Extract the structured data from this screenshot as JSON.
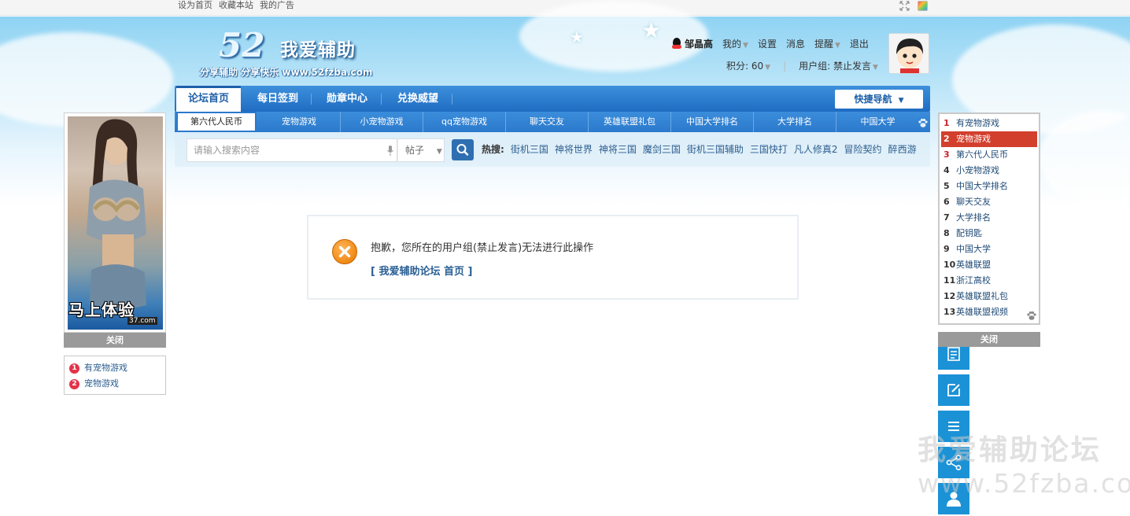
{
  "topbar": {
    "links": [
      "设为首页",
      "收藏本站",
      "我的广告"
    ]
  },
  "logo": {
    "number": "52",
    "title": "我爱辅助",
    "slogan": "分享辅助  分享快乐  www.52fzba.com"
  },
  "user": {
    "name": "邹晶高",
    "menu": [
      "我的",
      "设置",
      "消息",
      "提醒",
      "退出"
    ],
    "points": "积分: 60",
    "group": "用户组: 禁止发言"
  },
  "nav": {
    "tabs": [
      "论坛首页",
      "每日签到",
      "勋章中心",
      "兑换威望"
    ],
    "quick_nav": "快捷导航"
  },
  "subnav": [
    "第六代人民币",
    "宠物游戏",
    "小宠物游戏",
    "qq宠物游戏",
    "聊天交友",
    "英雄联盟礼包",
    "中国大学排名",
    "大学排名",
    "中国大学"
  ],
  "search": {
    "placeholder": "请输入搜索内容",
    "type": "帖子",
    "hot_label": "热搜:",
    "hot": [
      "街机三国",
      "神将世界",
      "神将三国",
      "魔剑三国",
      "街机三国辅助",
      "三国快打",
      "凡人修真2",
      "冒险契约",
      "醉西游"
    ]
  },
  "message": {
    "text": "抱歉，您所在的用户组(禁止发言)无法进行此操作",
    "link": "[ 我爱辅助论坛 首页 ]"
  },
  "left_ad": {
    "text": "马上体验",
    "brand": "37.com",
    "close": "关闭"
  },
  "left_list": [
    {
      "n": "1",
      "t": "有宠物游戏"
    },
    {
      "n": "2",
      "t": "宠物游戏"
    }
  ],
  "right_list": [
    {
      "n": "1",
      "t": "有宠物游戏"
    },
    {
      "n": "2",
      "t": "宠物游戏"
    },
    {
      "n": "3",
      "t": "第六代人民币"
    },
    {
      "n": "4",
      "t": "小宠物游戏"
    },
    {
      "n": "5",
      "t": "中国大学排名"
    },
    {
      "n": "6",
      "t": "聊天交友"
    },
    {
      "n": "7",
      "t": "大学排名"
    },
    {
      "n": "8",
      "t": "配钥匙"
    },
    {
      "n": "9",
      "t": "中国大学"
    },
    {
      "n": "10",
      "t": "英雄联盟"
    },
    {
      "n": "11",
      "t": "浙江高校"
    },
    {
      "n": "12",
      "t": "英雄联盟礼包"
    },
    {
      "n": "13",
      "t": "英雄联盟视频"
    }
  ],
  "right_close": "关闭",
  "side_buttons": [
    "document-icon",
    "edit-icon",
    "menu-icon",
    "share-icon",
    "user-icon"
  ],
  "watermark": {
    "line1": "我爱辅助论坛",
    "line2": "www.52fzba.com"
  },
  "colors": {
    "nav_blue": "#1f6cc2",
    "highlight_red": "#d33f2d",
    "side_blue": "#1b92d6"
  }
}
